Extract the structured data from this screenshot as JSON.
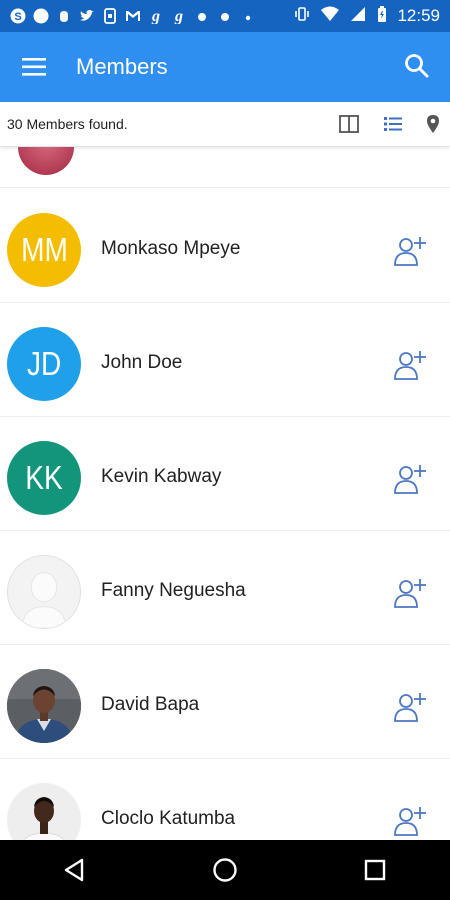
{
  "status_bar": {
    "time": "12:59",
    "left_icons": [
      "skype-icon",
      "circle-notification-icon",
      "fist-icon",
      "twitter-icon",
      "phone-app-icon",
      "gmail-icon",
      "g-icon",
      "g-icon",
      "dot-icon",
      "dot-icon",
      "dot-icon"
    ],
    "right_icons": [
      "vibrate-icon",
      "wifi-icon",
      "signal-icon",
      "battery-icon"
    ]
  },
  "app_bar": {
    "title": "Members",
    "background": "#2e8ff0"
  },
  "sub_bar": {
    "count_text": "30 Members found."
  },
  "members": [
    {
      "name": "Monkaso Mpeye",
      "initials": "MM",
      "avatar_color": "#f5bd00",
      "avatar_type": "initials"
    },
    {
      "name": "John Doe",
      "initials": "JD",
      "avatar_color": "#1fa0e8",
      "avatar_type": "initials"
    },
    {
      "name": "Kevin Kabway",
      "initials": "KK",
      "avatar_color": "#13957c",
      "avatar_type": "initials"
    },
    {
      "name": "Fanny Neguesha",
      "initials": "",
      "avatar_color": "#f0f0f0",
      "avatar_type": "placeholder"
    },
    {
      "name": "David Bapa",
      "initials": "",
      "avatar_color": "#3c3f44",
      "avatar_type": "photo"
    },
    {
      "name": "Cloclo Katumba",
      "initials": "",
      "avatar_color": "#e8e8e8",
      "avatar_type": "photo"
    }
  ],
  "accent_color": "#4c78c2"
}
